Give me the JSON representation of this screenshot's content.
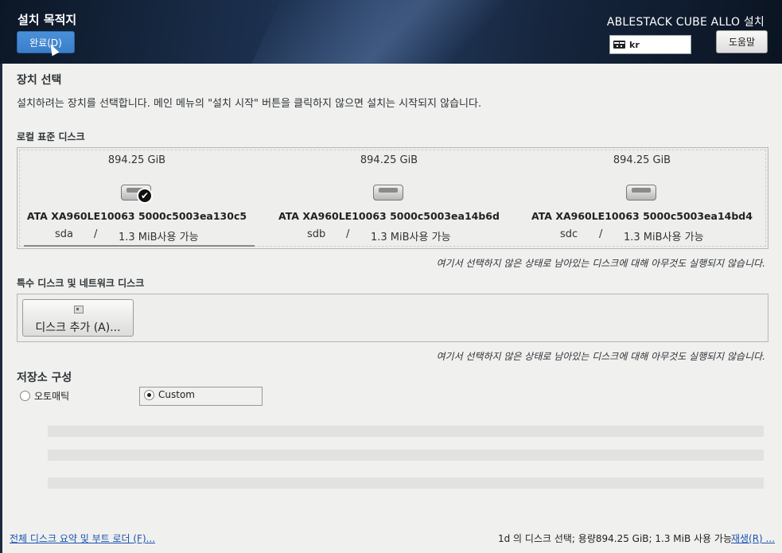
{
  "header": {
    "spoke_title": "설치 목적지",
    "done_label": "완료(D)",
    "product_title": "ABLESTACK CUBE ALLO 설치",
    "keyboard_layout": "kr",
    "help_label": "도움말"
  },
  "device_selection": {
    "title": "장치 선택",
    "description": "설치하려는 장치를 선택합니다. 메인 메뉴의 \"설치 시작\" 버튼을 클릭하지 않으면 설치는 시작되지 않습니다."
  },
  "local_disks": {
    "title": "로컬 표준 디스크",
    "disks": [
      {
        "capacity": "894.25 GiB",
        "model": "ATA XA960LE10063 5000c5003ea130c5",
        "name": "sda",
        "sep": "/",
        "free": "1.3 MiB사용 가능",
        "selected": true
      },
      {
        "capacity": "894.25 GiB",
        "model": "ATA XA960LE10063 5000c5003ea14b6d",
        "name": "sdb",
        "sep": "/",
        "free": "1.3 MiB사용 가능",
        "selected": false
      },
      {
        "capacity": "894.25 GiB",
        "model": "ATA XA960LE10063 5000c5003ea14bd4",
        "name": "sdc",
        "sep": "/",
        "free": "1.3 MiB사용 가능",
        "selected": false
      }
    ],
    "note": "여기서 선택하지 않은 상태로 남아있는 디스크에 대해 아무것도 실행되지 않습니다."
  },
  "special_disks": {
    "title": "특수 디스크 및 네트워크 디스크",
    "add_label": "디스크 추가 (A)...",
    "note": "여기서 선택하지 않은 상태로 남아있는 디스크에 대해 아무것도 실행되지 않습니다."
  },
  "storage_config": {
    "title": "저장소 구성",
    "automatic_label": "오토매틱",
    "custom_label": "Custom",
    "selected": "custom"
  },
  "footer": {
    "summary_link": "전체 디스크 요약 및 부트 로더 (F)...",
    "summary_text": "1d 의 디스크 선택; 용량894.25 GiB; 1.3 MiB 사용 가능",
    "refresh_link": "재생(R) ..."
  },
  "colors": {
    "accent": "#3a7fca",
    "header_bg": "#16253d",
    "link": "#1a55b0"
  }
}
